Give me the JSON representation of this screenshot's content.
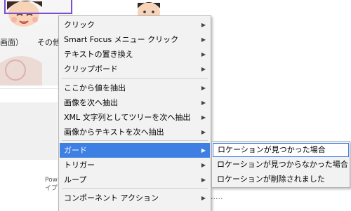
{
  "background": {
    "label_1": "画面）",
    "label_2": "その他",
    "small_text_1": "Pow",
    "small_text_2": "イプ",
    "dots": "....."
  },
  "context_menu": {
    "items": [
      {
        "label": "クリック",
        "has_submenu": true
      },
      {
        "label": "Smart Focus メニュー クリック",
        "has_submenu": true
      },
      {
        "label": "テキストの置き換え",
        "has_submenu": true
      },
      {
        "label": "クリップボード",
        "has_submenu": true
      },
      {
        "label": "ここから値を抽出",
        "has_submenu": true
      },
      {
        "label": "画像を次へ抽出",
        "has_submenu": true
      },
      {
        "label": "XML 文字列としてツリーを次へ抽出",
        "has_submenu": true
      },
      {
        "label": "画像からテキストを次へ抽出",
        "has_submenu": true
      },
      {
        "label": "ガード",
        "has_submenu": true,
        "active": true
      },
      {
        "label": "トリガー",
        "has_submenu": true
      },
      {
        "label": "ループ",
        "has_submenu": true
      },
      {
        "label": "コンポーネント アクション",
        "has_submenu": true
      }
    ],
    "arrow_glyph": "▶"
  },
  "guard_submenu": {
    "items": [
      {
        "label": "ロケーションが見つかった場合",
        "active": true
      },
      {
        "label": "ロケーションが見つからなかった場合"
      },
      {
        "label": "ロケーションが削除されました"
      }
    ]
  },
  "colors": {
    "highlight": "#3d7fe3",
    "menu_background": "#f2f2f2",
    "selection_border": "#7a4fd0"
  }
}
